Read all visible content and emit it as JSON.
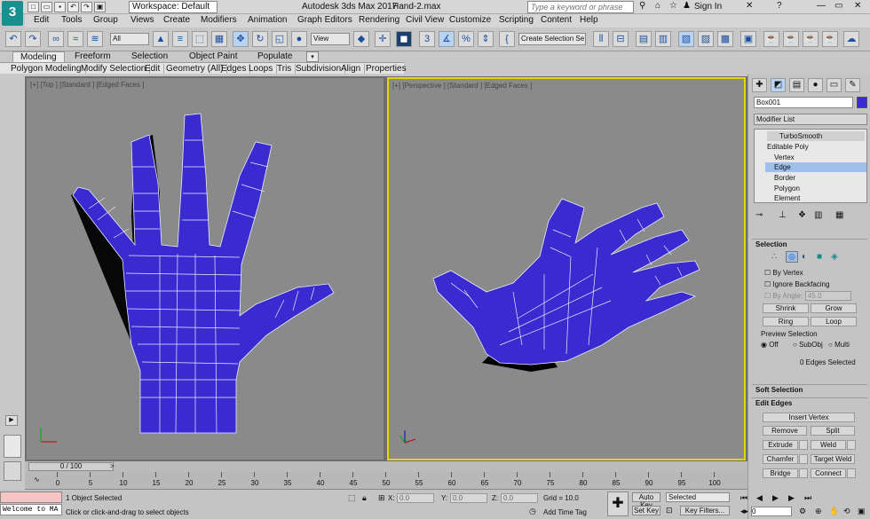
{
  "app": {
    "logo": "3",
    "workspace": "Workspace: Default",
    "title": "Autodesk 3ds Max 2017",
    "document": "Hand-2.max",
    "search_placeholder": "Type a keyword or phrase",
    "sign_in": "Sign In"
  },
  "menu": [
    "Edit",
    "Tools",
    "Group",
    "Views",
    "Create",
    "Modifiers",
    "Animation",
    "Graph Editors",
    "Rendering",
    "Civil View",
    "Customize",
    "Scripting",
    "Content",
    "Help"
  ],
  "toolbar": {
    "selection_filter": "All",
    "ref_coord": "View",
    "named_selection": "Create Selection Se"
  },
  "ribbon_tabs": [
    "Modeling",
    "Freeform",
    "Selection",
    "Object Paint",
    "Populate"
  ],
  "ribbon_panels": [
    "Polygon Modeling",
    "Modify Selection",
    "Edit",
    "Geometry (All)",
    "Edges",
    "Loops",
    "Tris",
    "Subdivision",
    "Align",
    "Properties"
  ],
  "viewports": {
    "top_label": "[+] [Top ] [Standard ] [Edged Faces ]",
    "persp_label": "[+] [Perspective ] [Standard ] [Edged Faces ]"
  },
  "command_panel": {
    "object_name": "Box001",
    "object_color": "#3a2bd1",
    "modifier_list": "Modifier List",
    "stack": [
      "TurboSmooth",
      "Editable Poly",
      "Vertex",
      "Edge",
      "Border",
      "Polygon",
      "Element"
    ],
    "selection_header": "Selection",
    "by_vertex": "By Vertex",
    "ignore_backfacing": "Ignore Backfacing",
    "by_angle": "By Angle:",
    "by_angle_value": "45.0",
    "shrink": "Shrink",
    "grow": "Grow",
    "ring": "Ring",
    "loop": "Loop",
    "preview_selection": "Preview Selection",
    "preview_off": "Off",
    "preview_subobj": "SubObj",
    "preview_multi": "Multi",
    "edges_selected": "0 Edges Selected",
    "soft_selection": "Soft Selection",
    "edit_edges": "Edit Edges",
    "insert_vertex": "Insert Vertex",
    "remove": "Remove",
    "split": "Split",
    "extrude": "Extrude",
    "weld": "Weld",
    "chamfer": "Chamfer",
    "target_weld": "Target Weld",
    "bridge": "Bridge",
    "connect": "Connect"
  },
  "timeline": {
    "frame": "0 / 100",
    "ticks": [
      "0",
      "5",
      "10",
      "15",
      "20",
      "25",
      "30",
      "35",
      "40",
      "45",
      "50",
      "55",
      "60",
      "65",
      "70",
      "75",
      "80",
      "85",
      "90",
      "95",
      "100"
    ]
  },
  "status": {
    "maxscript": "Welcome to MA",
    "selected": "1 Object Selected",
    "prompt": "Click or click-and-drag to select objects",
    "x_label": "X:",
    "x_value": "0.0",
    "y_label": "Y:",
    "y_value": "0.0",
    "z_label": "Z:",
    "z_value": "0.0",
    "grid": "Grid = 10.0",
    "add_time_tag": "Add Time Tag",
    "auto_key": "Auto Key",
    "set_key": "Set Key",
    "selected_set": "Selected",
    "key_filters": "Key Filters...",
    "current_frame": "0"
  }
}
